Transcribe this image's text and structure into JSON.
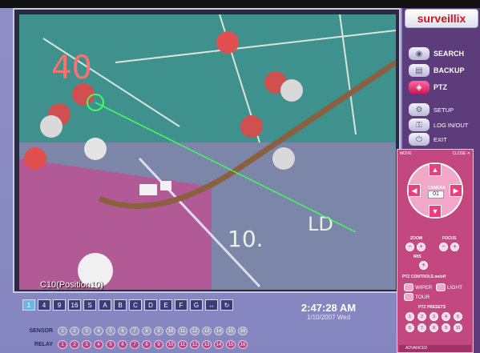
{
  "brand": {
    "logo_text": "surveillix"
  },
  "video": {
    "camera_label": "C10(Position10)"
  },
  "menu": {
    "search": "SEARCH",
    "backup": "BACKUP",
    "ptz": "PTZ",
    "setup": "SETUP",
    "login": "LOG IN/OUT",
    "exit": "EXIT"
  },
  "ptz": {
    "move_label": "MOVE",
    "close_label": "CLOSE",
    "camera_title": "CAMERA",
    "camera_value": "01",
    "zoom_label": "ZOOM",
    "focus_label": "FOCUS",
    "iris_label": "IRIS",
    "controls_title": "PTZ CONTROLS on/off",
    "wiper": "WIPER",
    "light": "LIGHT",
    "tour": "TOUR",
    "presets_title": "PTZ PRESETS",
    "advanced": "ADVANCED",
    "presets": [
      "1",
      "2",
      "3",
      "4",
      "5",
      "6",
      "7",
      "8",
      "9",
      "10"
    ]
  },
  "clock": {
    "time": "2:47:28 AM",
    "date": "1/10/2007 Wed"
  },
  "io": {
    "sensor_label": "SENSOR",
    "relay_label": "RELAY",
    "sensors": [
      "1",
      "2",
      "3",
      "4",
      "5",
      "6",
      "7",
      "8",
      "9",
      "10",
      "11",
      "12",
      "13",
      "14",
      "15",
      "16"
    ],
    "relays": [
      "1",
      "2",
      "3",
      "4",
      "5",
      "6",
      "7",
      "8",
      "9",
      "10",
      "11",
      "12",
      "13",
      "14",
      "15",
      "16"
    ]
  },
  "layout_buttons": [
    "1",
    "4",
    "9",
    "16",
    "S",
    "A",
    "B",
    "C",
    "D",
    "E",
    "F",
    "G",
    "↔",
    "↻"
  ],
  "colors": {
    "accent": "#d2141c",
    "ptz_panel": "#c44880",
    "frame": "#8585c0"
  }
}
